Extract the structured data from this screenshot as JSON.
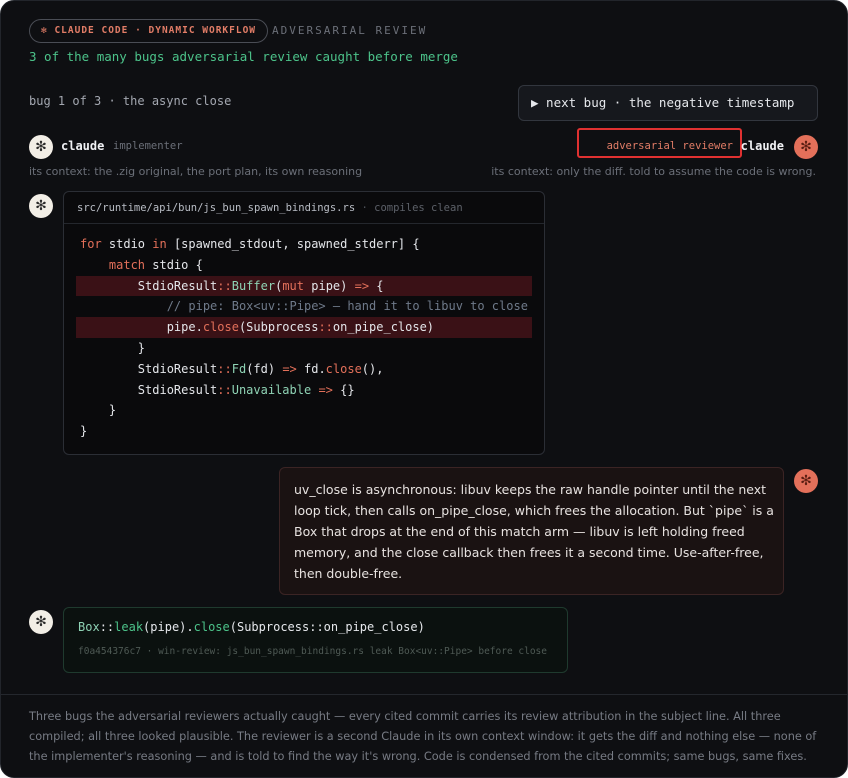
{
  "header": {
    "badge": "✻ CLAUDE CODE · DYNAMIC WORKFLOW",
    "kicker": "ADVERSARIAL REVIEW",
    "headline": "3 of the many bugs adversarial review caught before merge"
  },
  "nav": {
    "bug_label": "bug 1 of 3 · the async close",
    "next_button": "▶ next bug · the negative timestamp"
  },
  "avatar_glyph": "✻",
  "implementer": {
    "name": "claude",
    "role": "implementer",
    "context": "its context: the .zig original, the port plan, its own reasoning"
  },
  "reviewer": {
    "name": "claude",
    "role": "adversarial reviewer",
    "context": "its context: only the diff. told to assume the code is wrong."
  },
  "code": {
    "path": "src/runtime/api/bun/js_bun_spawn_bindings.rs",
    "sep": "·",
    "status": "compiles clean"
  },
  "review_lines": [
    "uv_close is asynchronous: libuv keeps the raw handle pointer until the next",
    "loop tick, then calls on_pipe_close, which frees the allocation. But `pipe` is a",
    "Box that drops at the end of this match arm — libuv is left holding freed",
    "memory, and the close callback then frees it a second time. Use-after-free,",
    "then double-free."
  ],
  "fix": {
    "commit": "f0a454376c7 · win-review: js_bun_spawn_bindings.rs leak Box<uv::Pipe> before close"
  },
  "footer_lines": [
    "Three bugs the adversarial reviewers actually caught — every cited commit carries its review attribution in the subject line. All three",
    "compiled; all three looked plausible. The reviewer is a second Claude in its own context window: it gets the diff and nothing else — none of",
    "the implementer's reasoning — and is told to find the way it's wrong. Code is condensed from the cited commits; same bugs, same fixes."
  ],
  "colors": {
    "accent_coral": "#e3705a",
    "accent_green": "#4cc38a",
    "highlight_red": "#3a1116",
    "annotation_red": "#e03131"
  }
}
